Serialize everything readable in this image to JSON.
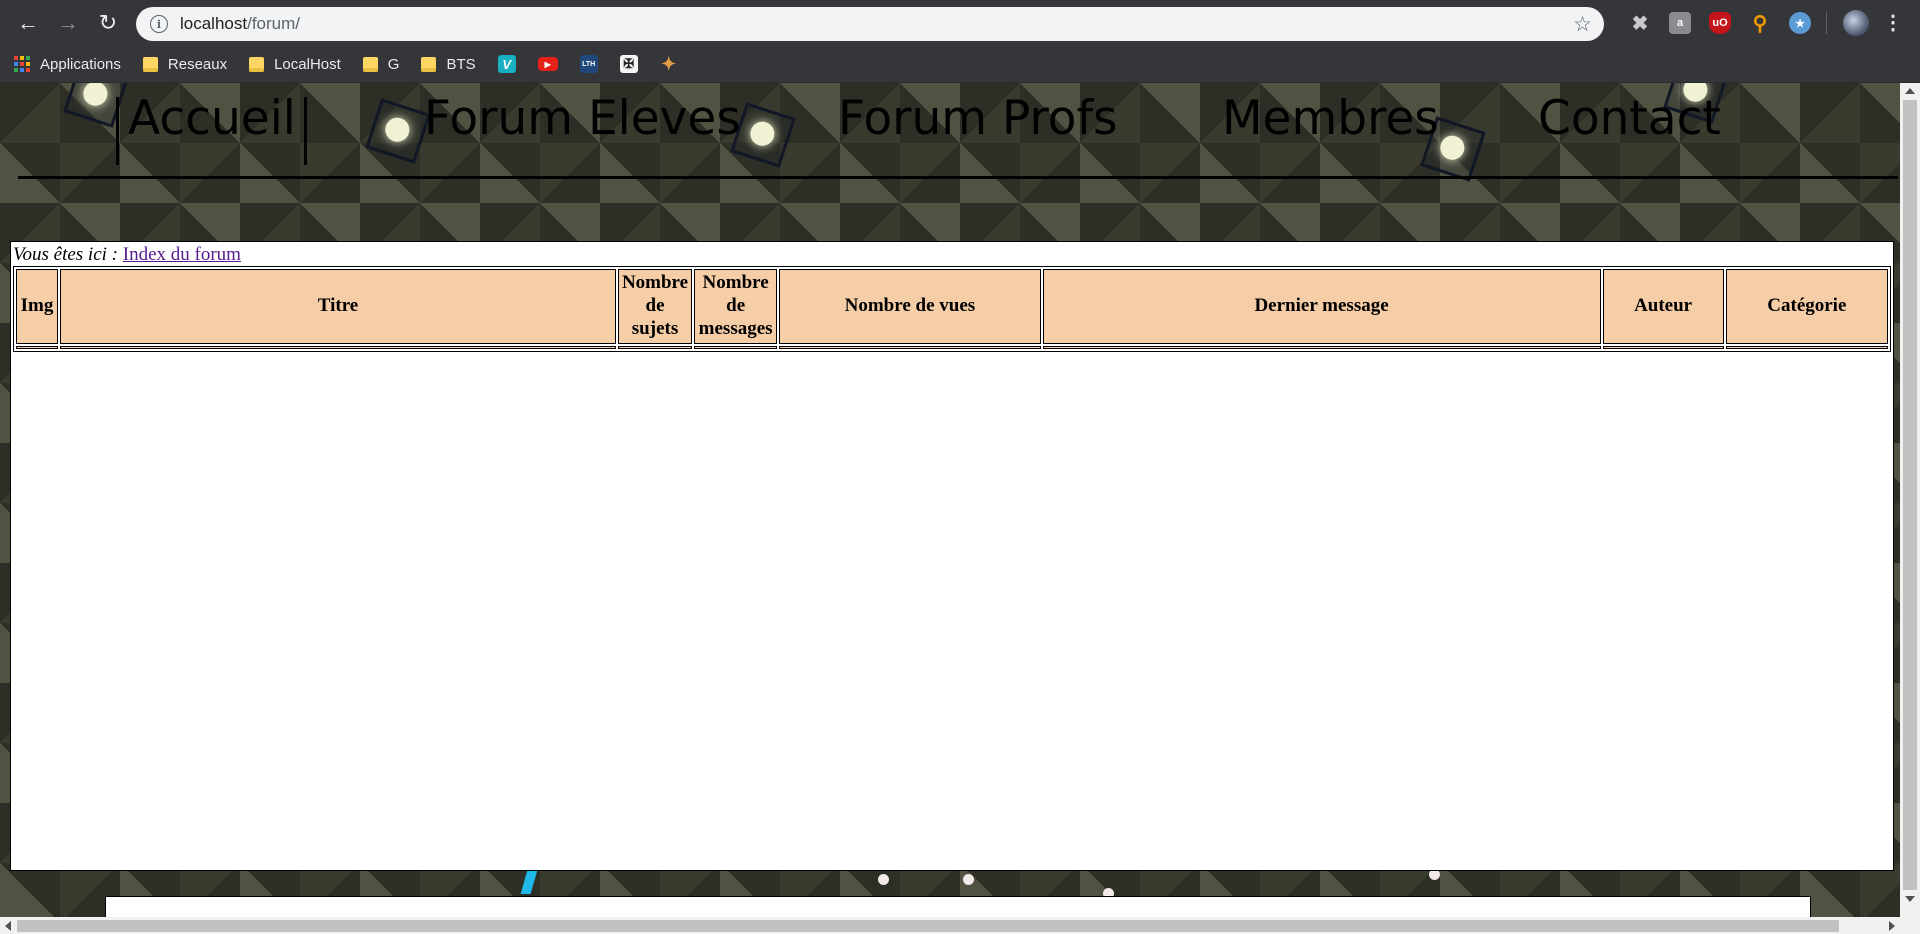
{
  "browser": {
    "url_host": "localhost",
    "url_path": "/forum/",
    "bookmarks": [
      {
        "label": "Applications",
        "icon": "apps-grid-icon"
      },
      {
        "label": "Reseaux",
        "icon": "folder-icon"
      },
      {
        "label": "LocalHost",
        "icon": "folder-icon"
      },
      {
        "label": "G",
        "icon": "folder-icon"
      },
      {
        "label": "BTS",
        "icon": "folder-icon"
      }
    ],
    "bookmark_icons": [
      {
        "name": "v-bookmark-icon",
        "color": "#17b1c1",
        "glyph": "V"
      },
      {
        "name": "youtube-bookmark-icon",
        "color": "#e62117",
        "glyph": "▶"
      },
      {
        "name": "lth-bookmark-icon",
        "color": "#20487a",
        "glyph": "LTH"
      },
      {
        "name": "site-bookmark-icon",
        "color": "#f4f4f4",
        "glyph": "✠"
      },
      {
        "name": "puzzle-bookmark-icon",
        "color": "#e59b4a",
        "glyph": "✦"
      }
    ]
  },
  "site_nav": {
    "items": [
      "Accueil",
      "Forum Eleves",
      "Forum Profs",
      "Membres",
      "Contact"
    ]
  },
  "breadcrumb": {
    "lead": "Vous êtes ici :",
    "link": "Index du forum"
  },
  "table": {
    "headers": [
      [
        "Img"
      ],
      [
        "Titre"
      ],
      [
        "Nombre",
        "de",
        "sujets"
      ],
      [
        "Nombre",
        "de",
        "messages"
      ],
      [
        "Nombre de vues"
      ],
      [
        "Dernier message"
      ],
      [
        "Auteur"
      ],
      [
        "Catégorie"
      ]
    ]
  },
  "colors": {
    "header_cell": "#f5cda6",
    "link_visited": "#551a8b"
  }
}
